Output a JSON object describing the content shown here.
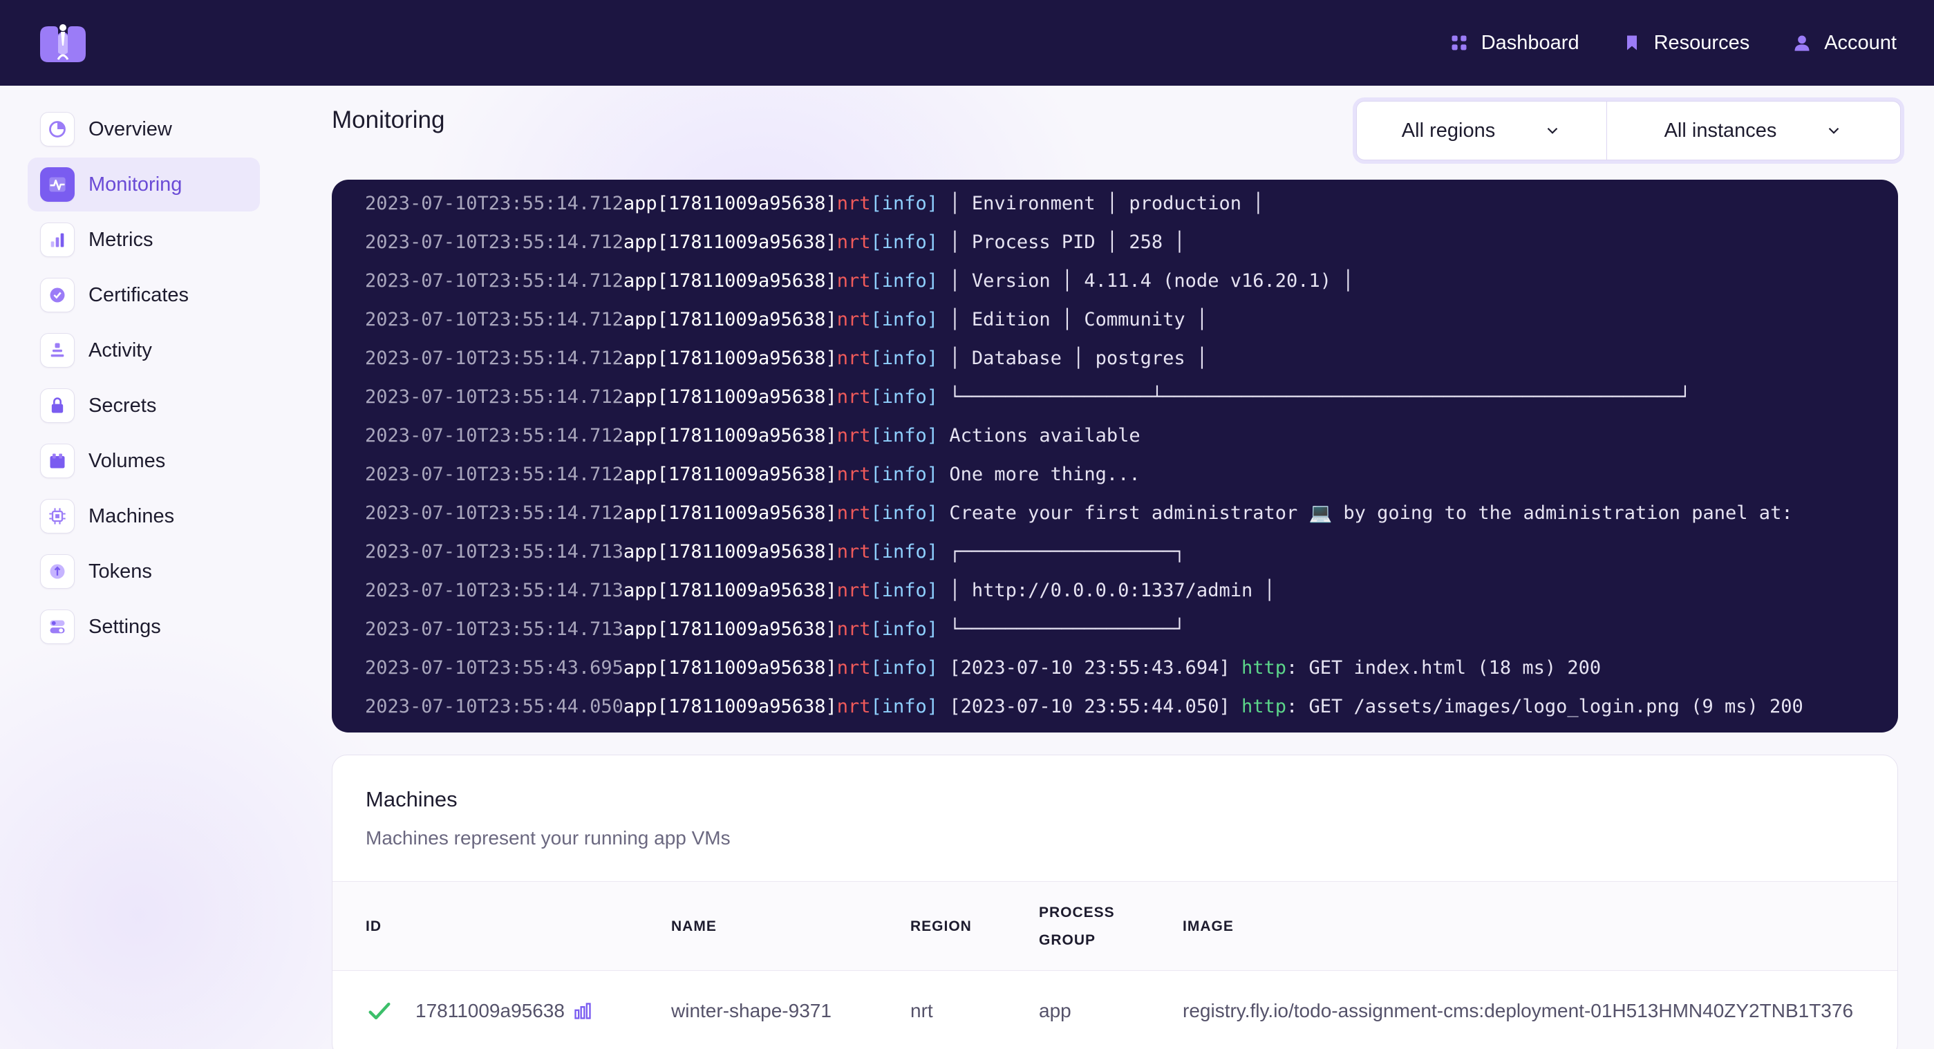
{
  "topnav": {
    "items": [
      {
        "label": "Dashboard",
        "icon": "grid-icon"
      },
      {
        "label": "Resources",
        "icon": "bookmark-icon"
      },
      {
        "label": "Account",
        "icon": "user-icon"
      }
    ]
  },
  "sidebar": {
    "items": [
      {
        "label": "Overview",
        "icon": "overview-icon"
      },
      {
        "label": "Monitoring",
        "icon": "pulse-icon",
        "active": true
      },
      {
        "label": "Metrics",
        "icon": "bar-chart-icon"
      },
      {
        "label": "Certificates",
        "icon": "badge-check-icon"
      },
      {
        "label": "Activity",
        "icon": "stack-icon"
      },
      {
        "label": "Secrets",
        "icon": "lock-icon"
      },
      {
        "label": "Volumes",
        "icon": "box-icon"
      },
      {
        "label": "Machines",
        "icon": "chip-icon"
      },
      {
        "label": "Tokens",
        "icon": "token-icon"
      },
      {
        "label": "Settings",
        "icon": "toggles-icon"
      }
    ]
  },
  "page": {
    "title": "Monitoring"
  },
  "filters": {
    "region": "All regions",
    "instance": "All instances"
  },
  "logs": [
    {
      "ts": "2023-07-10T23:55:14.712",
      "app": "app[17811009a95638]",
      "region": "nrt",
      "level": "[info]",
      "msg": " │ Environment │ production │"
    },
    {
      "ts": "2023-07-10T23:55:14.712",
      "app": "app[17811009a95638]",
      "region": "nrt",
      "level": "[info]",
      "msg": " │ Process PID │ 258 │"
    },
    {
      "ts": "2023-07-10T23:55:14.712",
      "app": "app[17811009a95638]",
      "region": "nrt",
      "level": "[info]",
      "msg": " │ Version │ 4.11.4 (node v16.20.1) │"
    },
    {
      "ts": "2023-07-10T23:55:14.712",
      "app": "app[17811009a95638]",
      "region": "nrt",
      "level": "[info]",
      "msg": " │ Edition │ Community │"
    },
    {
      "ts": "2023-07-10T23:55:14.712",
      "app": "app[17811009a95638]",
      "region": "nrt",
      "level": "[info]",
      "msg": " │ Database │ postgres │"
    },
    {
      "ts": "2023-07-10T23:55:14.712",
      "app": "app[17811009a95638]",
      "region": "nrt",
      "level": "[info]",
      "msg": " └─────────────────┴──────────────────────────────────────────────┘"
    },
    {
      "ts": "2023-07-10T23:55:14.712",
      "app": "app[17811009a95638]",
      "region": "nrt",
      "level": "[info]",
      "msg": " Actions available"
    },
    {
      "ts": "2023-07-10T23:55:14.712",
      "app": "app[17811009a95638]",
      "region": "nrt",
      "level": "[info]",
      "msg": " One more thing..."
    },
    {
      "ts": "2023-07-10T23:55:14.712",
      "app": "app[17811009a95638]",
      "region": "nrt",
      "level": "[info]",
      "msg": " Create your first administrator 💻 by going to the administration panel at:"
    },
    {
      "ts": "2023-07-10T23:55:14.713",
      "app": "app[17811009a95638]",
      "region": "nrt",
      "level": "[info]",
      "msg": " ┌───────────────────┐"
    },
    {
      "ts": "2023-07-10T23:55:14.713",
      "app": "app[17811009a95638]",
      "region": "nrt",
      "level": "[info]",
      "msg": " │ http://0.0.0.0:1337/admin │"
    },
    {
      "ts": "2023-07-10T23:55:14.713",
      "app": "app[17811009a95638]",
      "region": "nrt",
      "level": "[info]",
      "msg": " └───────────────────┘"
    },
    {
      "ts": "2023-07-10T23:55:43.695",
      "app": "app[17811009a95638]",
      "region": "nrt",
      "level": "[info]",
      "pre": " [2023-07-10 23:55:43.694] ",
      "http": "http",
      "msg": ": GET index.html (18 ms) 200"
    },
    {
      "ts": "2023-07-10T23:55:44.050",
      "app": "app[17811009a95638]",
      "region": "nrt",
      "level": "[info]",
      "pre": " [2023-07-10 23:55:44.050] ",
      "http": "http",
      "msg": ": GET /assets/images/logo_login.png (9 ms) 200"
    }
  ],
  "machines": {
    "title": "Machines",
    "subtitle": "Machines represent your running app VMs",
    "columns": {
      "id": "ID",
      "name": "NAME",
      "region": "REGION",
      "process_group": "PROCESS GROUP",
      "image": "IMAGE"
    },
    "rows": [
      {
        "id": "17811009a95638",
        "name": "winter-shape-9371",
        "region": "nrt",
        "process_group": "app",
        "image": "registry.fly.io/todo-assignment-cms:deployment-01H513HMN40ZY2TNB1T376"
      }
    ]
  },
  "colors": {
    "navbar": "#1c1541",
    "accent": "#7a5cf0",
    "success": "#3cbf6a",
    "log_region": "#f05a5a",
    "log_level": "#8fd0ff",
    "log_http": "#5cd68a"
  }
}
